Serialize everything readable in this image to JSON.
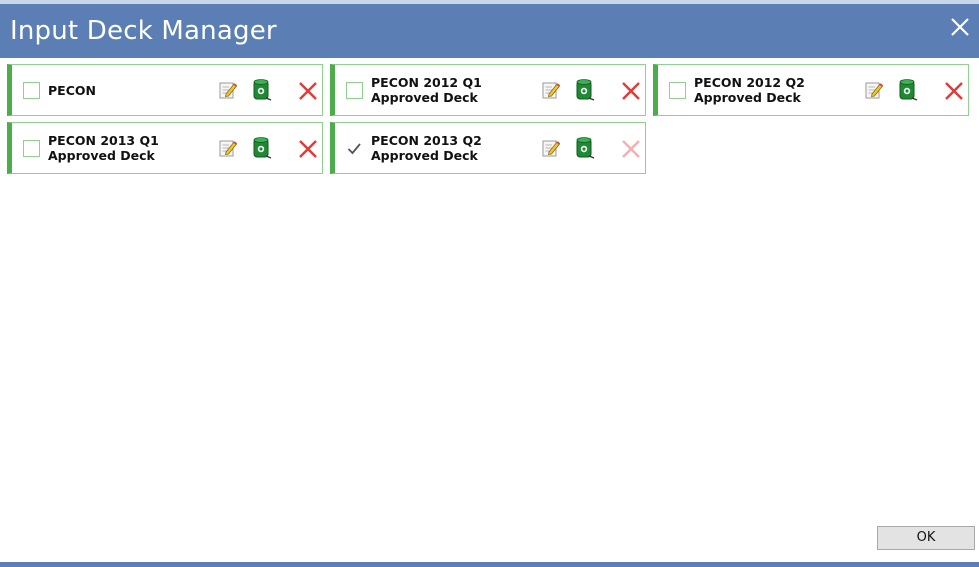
{
  "window": {
    "title": "Input Deck Manager"
  },
  "decks": [
    {
      "line1": "PECON",
      "line2": "",
      "checked": false,
      "delete_enabled": true
    },
    {
      "line1": "PECON 2012 Q1",
      "line2": "Approved Deck",
      "checked": false,
      "delete_enabled": true
    },
    {
      "line1": "PECON 2012 Q2",
      "line2": "Approved Deck",
      "checked": false,
      "delete_enabled": true
    },
    {
      "line1": "PECON 2013 Q1",
      "line2": "Approved Deck",
      "checked": false,
      "delete_enabled": true
    },
    {
      "line1": "PECON 2013 Q2",
      "line2": "Approved Deck",
      "checked": true,
      "delete_enabled": false
    }
  ],
  "icons": {
    "close": "close-icon",
    "edit": "edit-icon",
    "database": "database-icon",
    "delete": "delete-icon",
    "checkmark": "checkmark-icon"
  },
  "colors": {
    "titlebar": "#5b7fb4",
    "deck_accent": "#4cad4a",
    "deck_border": "#8fd18e",
    "delete_active": "#e53935",
    "delete_disabled": "#f4b0b0"
  },
  "footer": {
    "ok_label": "OK"
  }
}
